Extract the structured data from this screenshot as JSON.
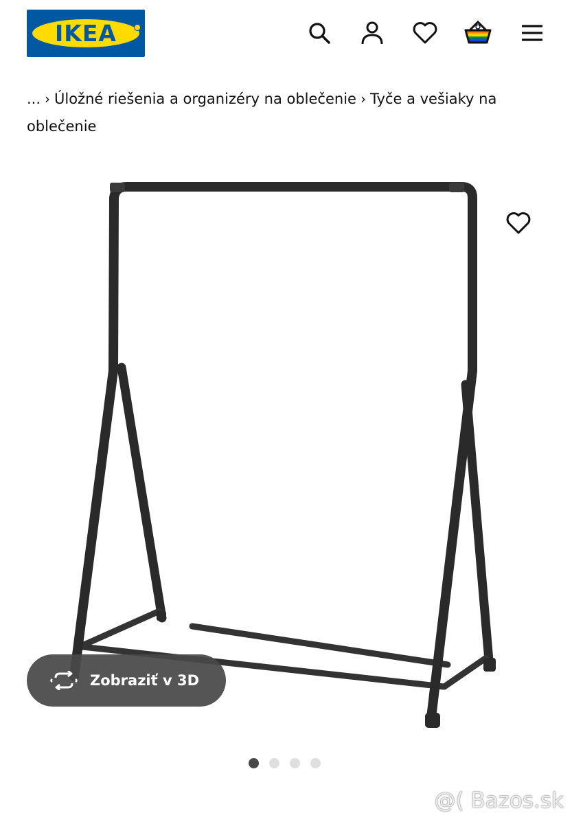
{
  "header": {
    "logo_text": "IKEA",
    "icons": [
      "search-icon",
      "account-icon",
      "heart-icon",
      "basket-icon",
      "menu-icon"
    ]
  },
  "breadcrumb": {
    "ellipsis": "...",
    "items": [
      "Úložné riešenia a organizéry na oblečenie",
      "Tyče a vešiaky na oblečenie"
    ]
  },
  "product": {
    "image_icon": "clothes-rack-image",
    "favorite_icon": "heart-icon",
    "view3d_label": "Zobraziť v 3D",
    "carousel": {
      "total": 4,
      "active": 1
    }
  },
  "watermark": "@( Bazos.sk",
  "colors": {
    "ikea_blue": "#0058a3",
    "ikea_yellow": "#ffdb00",
    "pill_bg": "#484848",
    "dot_active": "#484848",
    "dot_inactive": "#dfdfdf"
  }
}
